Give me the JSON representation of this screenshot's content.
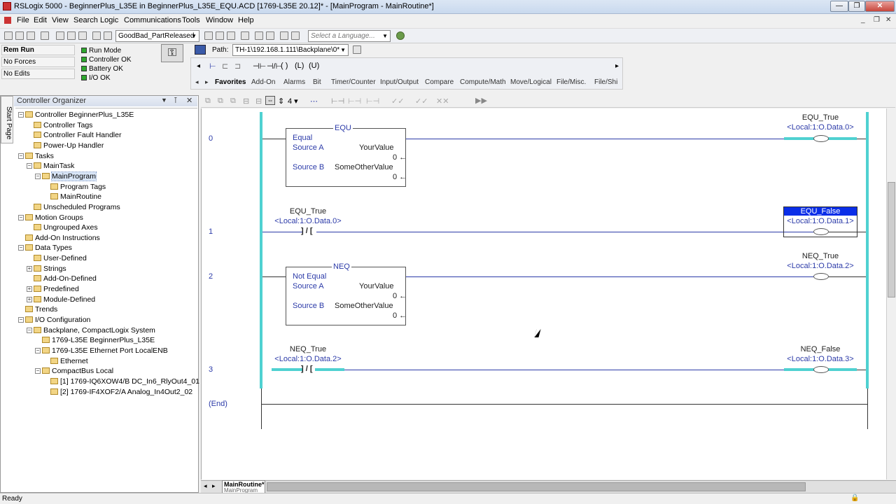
{
  "window": {
    "title": "RSLogix 5000 - BeginnerPlus_L35E in BeginnerPlus_L35E_EQU.ACD [1769-L35E 20.12]* - [MainProgram - MainRoutine*]",
    "min": "—",
    "max": "❐",
    "close": "✕"
  },
  "menu": [
    "File",
    "Edit",
    "View",
    "Search",
    "Logic",
    "Communications",
    "Tools",
    "Window",
    "Help"
  ],
  "toolbar": {
    "routine_combo": "GoodBad_PartReleased",
    "language_placeholder": "Select a Language..."
  },
  "status": {
    "mode": "Rem Run",
    "forces": "No Forces",
    "edits": "No Edits",
    "run_mode": "Run Mode",
    "controller_ok": "Controller OK",
    "battery_ok": "Battery OK",
    "io_ok": "I/O OK"
  },
  "path": {
    "label": "Path:",
    "value": "TH-1\\192.168.1.111\\Backplane\\0*"
  },
  "instr_tabs": [
    "Favorites",
    "Add-On",
    "Alarms",
    "Bit",
    "Timer/Counter",
    "Input/Output",
    "Compare",
    "Compute/Math",
    "Move/Logical",
    "File/Misc.",
    "File/Shi"
  ],
  "organizer": {
    "title": "Controller Organizer",
    "start_page": "Start Page",
    "items": [
      {
        "label": "Controller BeginnerPlus_L35E",
        "level": 0
      },
      {
        "label": "Controller Tags",
        "level": 1
      },
      {
        "label": "Controller Fault Handler",
        "level": 1
      },
      {
        "label": "Power-Up Handler",
        "level": 1
      },
      {
        "label": "Tasks",
        "level": 0
      },
      {
        "label": "MainTask",
        "level": 1
      },
      {
        "label": "MainProgram",
        "level": 2
      },
      {
        "label": "Program Tags",
        "level": 3
      },
      {
        "label": "MainRoutine",
        "level": 3
      },
      {
        "label": "Unscheduled Programs",
        "level": 1
      },
      {
        "label": "Motion Groups",
        "level": 0
      },
      {
        "label": "Ungrouped Axes",
        "level": 1
      },
      {
        "label": "Add-On Instructions",
        "level": 0
      },
      {
        "label": "Data Types",
        "level": 0
      },
      {
        "label": "User-Defined",
        "level": 1
      },
      {
        "label": "Strings",
        "level": 1
      },
      {
        "label": "Add-On-Defined",
        "level": 1
      },
      {
        "label": "Predefined",
        "level": 1
      },
      {
        "label": "Module-Defined",
        "level": 1
      },
      {
        "label": "Trends",
        "level": 0
      },
      {
        "label": "I/O Configuration",
        "level": 0
      },
      {
        "label": "Backplane, CompactLogix System",
        "level": 1
      },
      {
        "label": "1769-L35E BeginnerPlus_L35E",
        "level": 2
      },
      {
        "label": "1769-L35E Ethernet Port LocalENB",
        "level": 2
      },
      {
        "label": "Ethernet",
        "level": 3
      },
      {
        "label": "CompactBus Local",
        "level": 2
      },
      {
        "label": "[1] 1769-IQ6XOW4/B DC_In6_RlyOut4_01",
        "level": 3
      },
      {
        "label": "[2] 1769-IF4XOF2/A Analog_In4Out2_02",
        "level": 3
      }
    ]
  },
  "ladder": {
    "rung0": {
      "num": "0",
      "box_title": "EQU",
      "box_name": "Equal",
      "srcA": "Source A",
      "srcA_tag": "YourValue",
      "srcA_val": "0 ←",
      "srcB": "Source B",
      "srcB_tag": "SomeOtherValue",
      "srcB_val": "0 ←",
      "coil_tag": "EQU_True",
      "coil_addr": "<Local:1:O.Data.0>"
    },
    "rung1": {
      "num": "1",
      "contact_tag": "EQU_True",
      "contact_addr": "<Local:1:O.Data.0>",
      "contact_sym": "] / [",
      "coil_tag": "EQU_False",
      "coil_addr": "<Local:1:O.Data.1>"
    },
    "rung2": {
      "num": "2",
      "box_title": "NEQ",
      "box_name": "Not Equal",
      "srcA": "Source A",
      "srcA_tag": "YourValue",
      "srcA_val": "0 ←",
      "srcB": "Source B",
      "srcB_tag": "SomeOtherValue",
      "srcB_val": "0 ←",
      "coil_tag": "NEQ_True",
      "coil_addr": "<Local:1:O.Data.2>"
    },
    "rung3": {
      "num": "3",
      "contact_tag": "NEQ_True",
      "contact_addr": "<Local:1:O.Data.2>",
      "contact_sym": "] / [",
      "coil_tag": "NEQ_False",
      "coil_addr": "<Local:1:O.Data.3>"
    },
    "end": "(End)"
  },
  "bottom_tab": {
    "label": "MainRoutine*",
    "sub": "MainProgram"
  },
  "statusbar": {
    "text": "Ready"
  },
  "colors": {
    "energized": "#4fd1d1",
    "rail": "#4fd1d1",
    "selected": "#0a2ee8"
  }
}
